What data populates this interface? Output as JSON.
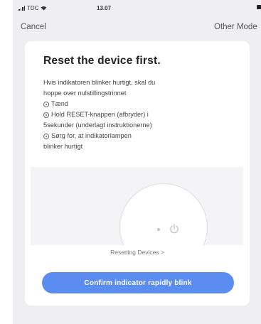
{
  "status_bar": {
    "carrier": "TDC",
    "network": "",
    "time": "13.07"
  },
  "nav": {
    "cancel_label": "Cancel",
    "other_mode_label": "Other Mode"
  },
  "card": {
    "title": "Reset the device first.",
    "intro_lines": [
      "Hvis indikatoren blinker hurtigt, skal du",
      "hoppe over nulstillingstrinnet"
    ],
    "steps": [
      {
        "lines": [
          "Tænd"
        ]
      },
      {
        "lines": [
          "Hold RESET-knappen  (afbryder)  i",
          "5sekunder (underlagt instruktionerne)"
        ]
      },
      {
        "lines": [
          "Sørg for, at indikatorlampen",
          "blinker hurtigt"
        ]
      }
    ],
    "reset_link": "Resetting Devices >",
    "confirm_label": "Confirm indicator rapidly blink"
  },
  "colors": {
    "accent": "#5b8df0",
    "background": "#efeff1",
    "card": "#ffffff"
  },
  "icons": {
    "step_marker": "circle-dot-icon",
    "device_power": "power-icon",
    "wifi": "wifi-icon",
    "battery": "battery-icon"
  }
}
